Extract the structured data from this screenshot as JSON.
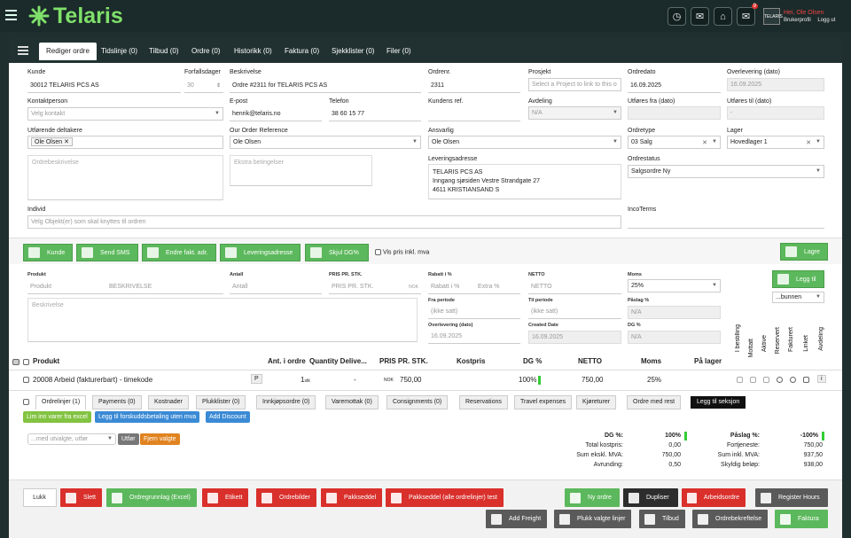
{
  "app": {
    "brand": "Telaris",
    "brand_color": "#7fe06a"
  },
  "header": {
    "icons": [
      "clock-icon",
      "chat-icon",
      "tag-icon",
      "mail-icon"
    ],
    "mail_badge": "9",
    "user_name": "Hei, Ole Olsen",
    "profile_link": "Brukerprofil",
    "logout_link": "Logg ut"
  },
  "tabs": [
    "Rediger ordre",
    "Tidslinje (0)",
    "Tilbud (0)",
    "Ordre (0)",
    "Historikk (0)",
    "Faktura (0)",
    "Sjekklister (0)",
    "Filer (0)"
  ],
  "form": {
    "kunde": {
      "label": "Kunde",
      "value": "30012 TELARIS PCS AS"
    },
    "forfallsdager": {
      "label": "Forfallsdager",
      "value": "30"
    },
    "beskrivelse": {
      "label": "Beskrivelse",
      "value": "Ordre #2311 for TELARIS PCS AS"
    },
    "ordrenr": {
      "label": "Ordrenr.",
      "value": "2311"
    },
    "prosjekt": {
      "label": "Prosjekt",
      "placeholder": "Select a Project to link to this o"
    },
    "ordredato": {
      "label": "Ordredato",
      "value": "16.09.2025"
    },
    "overlevering": {
      "label": "Overlevering (dato)",
      "value": "16.09.2025"
    },
    "kontaktperson": {
      "label": "Kontaktperson",
      "placeholder": "Velg kontakt"
    },
    "epost": {
      "label": "E-post",
      "value": "henrik@telaris.no"
    },
    "telefon": {
      "label": "Telefon",
      "value": "38 60 15 77"
    },
    "kundens_ref": {
      "label": "Kundens ref.",
      "value": ""
    },
    "avdeling": {
      "label": "Avdeling",
      "value": "N/A"
    },
    "utfores_fra": {
      "label": "Utføres fra (dato)",
      "value": ""
    },
    "utfores_til": {
      "label": "Utføres til (dato)",
      "value": "-"
    },
    "utforende": {
      "label": "Utførende deltakere",
      "chip": "Ole Olsen"
    },
    "our_ref": {
      "label": "Our Order Reference",
      "value": "Ole Olsen"
    },
    "ansvarlig": {
      "label": "Ansvarlig",
      "value": "Ole Olsen"
    },
    "ordretype": {
      "label": "Ordretype",
      "value": "03 Salg"
    },
    "lager": {
      "label": "Lager",
      "value": "Hovedlager 1"
    },
    "ordrebeskrivelse": {
      "placeholder": "Ordrebeskrivelse"
    },
    "ekstra": {
      "placeholder": "Ekstra betingelser"
    },
    "leveringsadresse": {
      "label": "Leveringsadresse",
      "lines": [
        "TELARIS PCS AS",
        "Inngang sjøsiden Vestre Strandgate 27",
        "4611 KRISTIANSAND S"
      ]
    },
    "ordrestatus": {
      "label": "Ordrestatus",
      "value": "Salgsordre Ny"
    },
    "individ": {
      "label": "Individ",
      "placeholder": "Velg Objekt(er) som skal knyttes til ordren"
    },
    "incoterms": {
      "label": "IncoTerms"
    }
  },
  "actions": {
    "kunde": "Kunde",
    "sms": "Send SMS",
    "fakt": "Endre fakt. adr.",
    "lev": "Leveringsadresse",
    "dg": "Skjul DG%",
    "vis_pris": "Vis pris inkl. mva",
    "lagre": "Lagre"
  },
  "product_form": {
    "produkt": "Produkt",
    "produkt_ph": "Produkt",
    "beskr_ph": "BESKRIVELSE",
    "beskrivelse_ph": "Beskrivelse",
    "antall": "Antall",
    "antall_ph": "Antall",
    "pris": "PRIS PR. STK.",
    "pris_ph": "PRIS PR. STK.",
    "currency": "NOK",
    "rabatt": "Rabatt i %",
    "rabatt_ph": "Rabatt i %",
    "extra_ph": "Extra %",
    "netto": "NETTO",
    "netto_ph": "NETTO",
    "moms": "Moms",
    "moms_val": "25%",
    "fra": "Fra periode",
    "fra_ph": "(ikke satt)",
    "til": "Til periode",
    "til_ph": "(ikke satt)",
    "paslag": "Påslag %",
    "paslag_val": "N/A",
    "overlevering": "Overlevering (dato)",
    "overlevering_val": "16.09.2025",
    "created": "Created Date",
    "created_val": "16.09.2025",
    "dg": "DG %",
    "dg_val": "N/A",
    "legg_til": "Legg til",
    "position": "...bunnen"
  },
  "vertical_headers": [
    "I bestilling",
    "Mottatt",
    "Aktive",
    "Reservert",
    "Fakturert",
    "Linket",
    "Avdeling"
  ],
  "table": {
    "headers": {
      "produkt": "Produkt",
      "antall": "Ant. i ordre",
      "qty": "Quantity Delive...",
      "pris": "PRIS PR. STK.",
      "kostpris": "Kostpris",
      "dg": "DG %",
      "netto": "NETTO",
      "moms": "Moms",
      "lager": "På lager"
    },
    "row": {
      "produkt": "20008 Arbeid (fakturerbart) - timekode",
      "tag": "P",
      "antall": "1",
      "unit": "stk",
      "qty": "-",
      "currency": "NOK",
      "pris": "750,00",
      "dg": "100%",
      "netto": "750,00",
      "moms": "25%",
      "info": "i"
    }
  },
  "subtabs": [
    "Ordrelinjer (1)",
    "Payments (0)",
    "Kostnader",
    "Plukklister (0)",
    "Innkjøpsordre (0)",
    "Varemottak (0)",
    "Consignments (0)",
    "Reservations",
    "Travel expenses",
    "Kjøreturer",
    "Ordre med rest",
    "Legg til seksjon"
  ],
  "small_buttons": {
    "lim_inn": "Lim inn varer fra excel",
    "forskudd": "Legg til forskuddsbetaling uten mva",
    "discount": "Add Discount",
    "select_ph": "...med utvalgte, utfør",
    "utfor": "Utfør",
    "fravalgte": "Fjern valgte"
  },
  "summary": {
    "dg": {
      "label": "DG %:",
      "value": "100%"
    },
    "kostpris": {
      "label": "Total kostpris:",
      "value": "0,00"
    },
    "sum_eks": {
      "label": "Sum ekskl. MVA:",
      "value": "750,00"
    },
    "avrunding": {
      "label": "Avrunding:",
      "value": "0,50"
    },
    "paslag": {
      "label": "Påslag %:",
      "value": "-100%"
    },
    "fortjeneste": {
      "label": "Fortjeneste:",
      "value": "750,00"
    },
    "sum_inkl": {
      "label": "Sum inkl. MVA:",
      "value": "937,50"
    },
    "skyldig": {
      "label": "Skyldig beløp:",
      "value": "938,00"
    }
  },
  "footer": {
    "lukk": "Lukk",
    "slett": "Slett",
    "grunnlag": "Ordregrunnlag (Excel)",
    "etikett": "Etikett",
    "bilder": "Ordrebilder",
    "pakkseddel": "Pakkseddel",
    "pakkseddel_test": "Pakkseddel (alle ordrelinjer) test",
    "ny_ordre": "Ny ordre",
    "dupliser": "Dupliser",
    "arbeidsordre": "Arbeidsordre",
    "register": "Register Hours",
    "freight": "Add Freight",
    "plukk": "Plukk valgte linjer",
    "tilbud": "Tilbud",
    "bekreftelse": "Ordrebekreftelse",
    "faktura": "Faktura"
  }
}
